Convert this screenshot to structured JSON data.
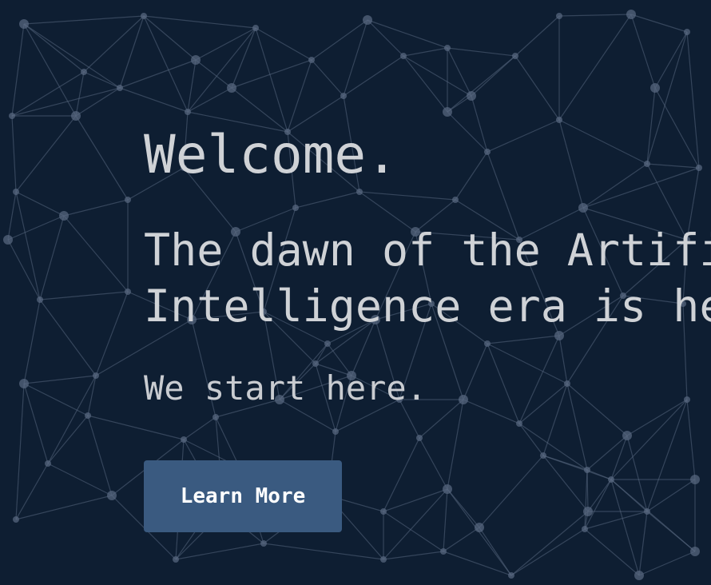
{
  "hero": {
    "welcome": "Welcome.",
    "tagline_line1": "The dawn of the Artificial",
    "tagline_line2": "Intelligence era is here.",
    "subline": "We start here.",
    "cta_label": "Learn More"
  },
  "colors": {
    "background": "#0e1e32",
    "network_lines": "#4a5a72",
    "text": "#cfd2d6",
    "button": "#3a5a80",
    "button_text": "#ffffff"
  },
  "background": {
    "icon": "network-graph-pattern"
  }
}
